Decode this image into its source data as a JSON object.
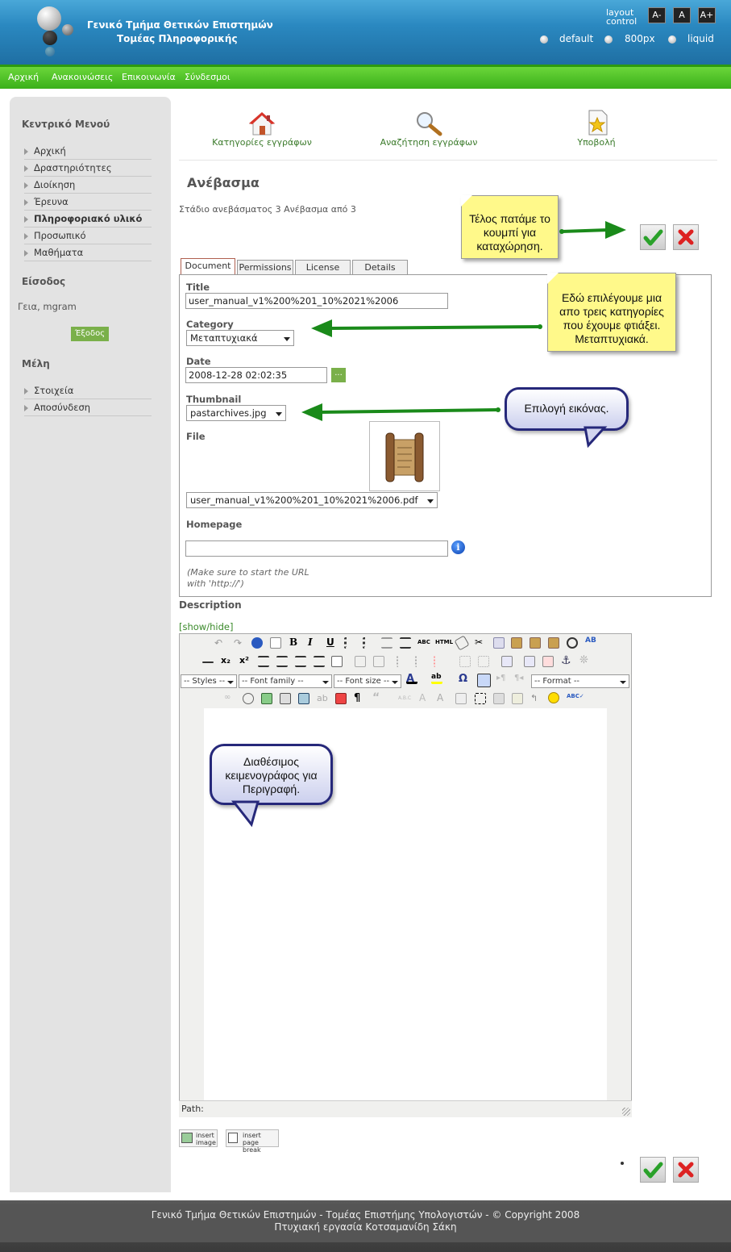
{
  "header": {
    "title_line1": "Γενικό Τμήμα Θετικών Επιστημών",
    "title_line2": "Τομέας Πληροφορικής",
    "layout_control_line1": "layout",
    "layout_control_line2": "control",
    "font_buttons": [
      "A-",
      "A",
      "A+"
    ],
    "layout_options": [
      "default",
      "800px",
      "liquid"
    ]
  },
  "navbar": {
    "items": [
      "Αρχική",
      "Ανακοινώσεις",
      "Επικοινωνία",
      "Σύνδεσμοι"
    ]
  },
  "sidebar": {
    "main_menu_title": "Κεντρικό Μενού",
    "main_menu": [
      "Αρχική",
      "Δραστηριότητες",
      "Διοίκηση",
      "Έρευνα",
      "Πληροφοριακό υλικό",
      "Προσωπικό",
      "Μαθήματα"
    ],
    "login_title": "Είσοδος",
    "greeting": "Γεια, mgram",
    "logout_label": "Έξοδος",
    "members_title": "Μέλη",
    "members_menu": [
      "Στοιχεία",
      "Αποσύνδεση"
    ]
  },
  "top_icons": {
    "categories": "Κατηγορίες εγγράφων",
    "search": "Αναζήτηση εγγράφων",
    "submit": "Υποβολή"
  },
  "page": {
    "title": "Ανέβασμα",
    "stage": "Στάδιο ανεβάσματος 3 Ανέβασμα από 3"
  },
  "tabs": [
    "Document",
    "Permissions",
    "License",
    "Details"
  ],
  "form": {
    "title_label": "Title",
    "title_value": "user_manual_v1%200%201_10%2021%2006",
    "category_label": "Category",
    "category_value": "Μεταπτυχιακά",
    "date_label": "Date",
    "date_value": "2008-12-28 02:02:35",
    "date_button": "...",
    "thumbnail_label": "Thumbnail",
    "thumbnail_value": "pastarchives.jpg",
    "file_label": "File",
    "file_value": "user_manual_v1%200%201_10%2021%2006.pdf",
    "homepage_label": "Homepage",
    "homepage_value": "",
    "note_line1": "(Make sure to start the URL",
    "note_line2": "with 'http://')"
  },
  "description": {
    "label": "Description",
    "toggle": "[show/hide]"
  },
  "editor": {
    "styles": "-- Styles --",
    "font_family": "-- Font family --",
    "font_size": "-- Font size --",
    "format": "-- Format --",
    "path_label": "Path:",
    "insert_image_line1": "insert",
    "insert_image_line2": "image",
    "page_break_line1": "insert",
    "page_break_line2": "page break"
  },
  "annotations": {
    "save_note": "Τέλος πατάμε το κουμπί για καταχώρηση.",
    "category_note": "Εδώ επιλέγουμε μια απο τρεις κατηγορίες που έχουμε φτιάξει. Μεταπτυχιακά.",
    "image_note": "Επιλογή εικόνας.",
    "editor_note": "Διαθέσιμος κειμενογράφος για Περιγραφή."
  },
  "footer": {
    "line1": "Γενικό Τμήμα Θετικών Επιστημών - Τομέας Επιστήμης Υπολογιστών - © Copyright 2008",
    "line2": "Πτυχιακή εργασία Κοτσαμανίδη Σάκη"
  },
  "colors": {
    "header_blue": "#2a88c0",
    "nav_green": "#4cc428",
    "arrow_green": "#1a8a1a",
    "bubble_border": "#26287a"
  }
}
